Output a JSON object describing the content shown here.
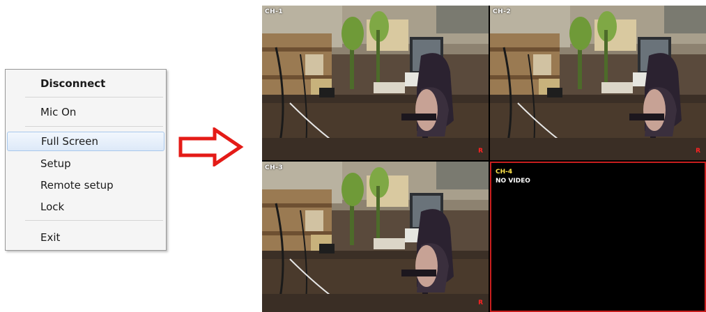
{
  "context_menu": {
    "items": [
      {
        "label": "Disconnect"
      },
      {
        "label": "Mic On"
      },
      {
        "label": "Full Screen"
      },
      {
        "label": "Setup"
      },
      {
        "label": "Remote setup"
      },
      {
        "label": "Lock"
      },
      {
        "label": "Exit"
      }
    ],
    "highlighted_item": "Full Screen"
  },
  "arrow": {
    "color": "#e41b17",
    "icon": "right-arrow-icon"
  },
  "video_grid": {
    "channels": [
      {
        "label": "CH-1",
        "status_badge": "R"
      },
      {
        "label": "CH-2",
        "status_badge": "R"
      },
      {
        "label": "CH-3",
        "status_badge": "R"
      },
      {
        "label": "CH-4",
        "message": "NO VIDEO"
      }
    ],
    "colors": {
      "no_video_border": "#c81e1e",
      "channel_label_active": "#ffe34a",
      "rec_badge": "#ff2222"
    }
  }
}
